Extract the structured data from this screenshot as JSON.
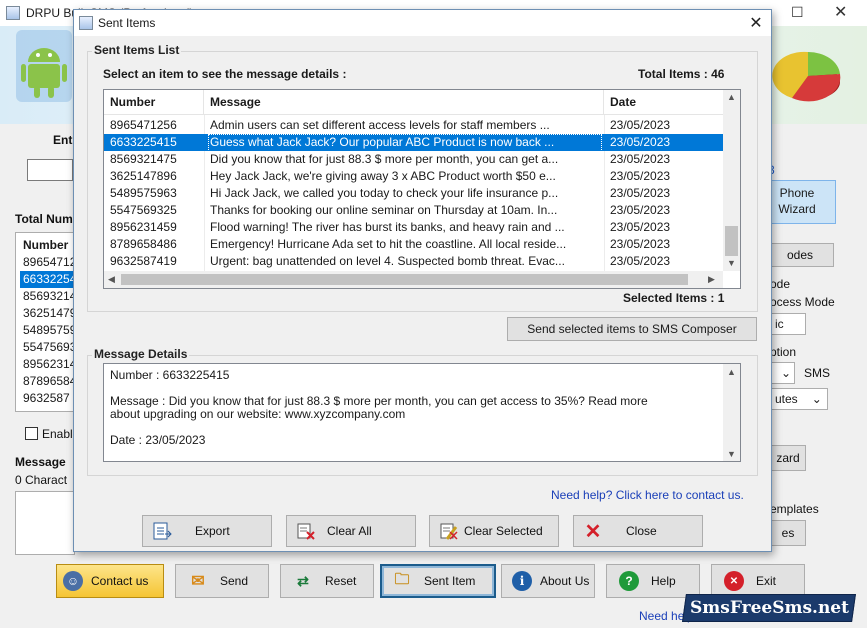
{
  "main_window": {
    "title": "DRPU Bulk SMS (Professional)",
    "labels": {
      "enter": "Ent",
      "total_numbers": "Total Num",
      "number_col": "Number",
      "enable": "Enabl",
      "message": "Message",
      "characters": "0 Charact",
      "wizard_line1": "Phone",
      "wizard_line2": "Wizard",
      "modes_btn": "odes",
      "mode": "ode",
      "process_mode": "ocess Mode",
      "ic_field": "ic",
      "option": "ption",
      "sms": "SMS",
      "minutes": "utes",
      "wizard_btn": "zard",
      "templates": "emplates",
      "es_btn": "es",
      "right_num": "3"
    },
    "numbers_list": [
      "89654712",
      "66332254",
      "85693214",
      "36251479",
      "54895759",
      "55475693",
      "89562314",
      "87896584",
      "9632587"
    ],
    "toolbar": {
      "contact_us": "Contact us",
      "send": "Send",
      "reset": "Reset",
      "sent_item": "Sent Item",
      "about_us": "About Us",
      "help": "Help",
      "exit": "Exit"
    },
    "need_help": "Need help",
    "watermark": "SmsFreeSms.net"
  },
  "dialog": {
    "title": "Sent Items",
    "list_group_title": "Sent Items List",
    "select_prompt": "Select an item to see the message details :",
    "total_items": "Total Items : 46",
    "columns": [
      "Number",
      "Message",
      "Date"
    ],
    "rows": [
      {
        "number": "8965471256",
        "message": "Admin users can set different access levels for staff members ...",
        "date": "23/05/2023",
        "selected": false
      },
      {
        "number": "6633225415",
        "message": "Guess what Jack Jack? Our popular ABC Product is now back ...",
        "date": "23/05/2023",
        "selected": true
      },
      {
        "number": "8569321475",
        "message": "Did you know that for just 88.3 $ more per month, you can get a...",
        "date": "23/05/2023",
        "selected": false
      },
      {
        "number": "3625147896",
        "message": "Hey Jack Jack, we're giving away 3 x ABC Product worth $50 e...",
        "date": "23/05/2023",
        "selected": false
      },
      {
        "number": "5489575963",
        "message": "Hi Jack Jack, we called you today to check your life insurance p...",
        "date": "23/05/2023",
        "selected": false
      },
      {
        "number": "5547569325",
        "message": "Thanks for booking our online seminar on Thursday at 10am. In...",
        "date": "23/05/2023",
        "selected": false
      },
      {
        "number": "8956231459",
        "message": "Flood warning! The river has burst its banks, and heavy rain and ...",
        "date": "23/05/2023",
        "selected": false
      },
      {
        "number": "8789658486",
        "message": "Emergency! Hurricane Ada set to hit the coastline. All local reside...",
        "date": "23/05/2023",
        "selected": false
      },
      {
        "number": "9632587419",
        "message": "Urgent: bag unattended on level 4. Suspected bomb threat. Evac...",
        "date": "23/05/2023",
        "selected": false
      }
    ],
    "selected_items": "Selected Items : 1",
    "send_composer_button": "Send selected items to SMS Composer",
    "details_group_title": "Message Details",
    "details": {
      "number_line": "Number   :  6633225415",
      "message_line1": "Message  :  Did you know that for just 88.3 $ more per month, you can get access to 35%? Read more",
      "message_line2": "about upgrading on our website: www.xyzcompany.com",
      "date_line": "Date       :  23/05/2023"
    },
    "need_help": "Need help? Click here to contact us.",
    "buttons": {
      "export": "Export",
      "clear_all": "Clear All",
      "clear_selected": "Clear Selected",
      "close": "Close"
    }
  },
  "colors": {
    "selection": "#0078d7",
    "link": "#1a3fb8",
    "close_x": "#d4202a"
  }
}
